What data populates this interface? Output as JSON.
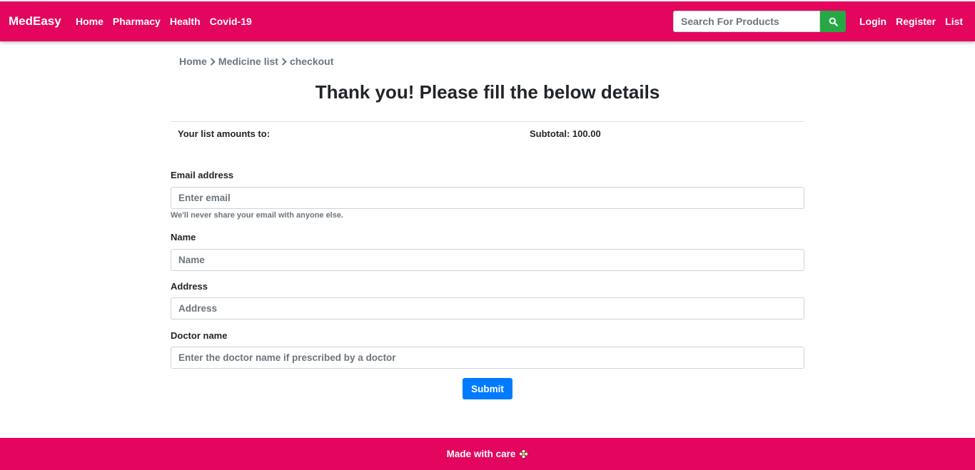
{
  "navbar": {
    "brand": "MedEasy",
    "links": [
      "Home",
      "Pharmacy",
      "Health",
      "Covid-19"
    ],
    "search": {
      "placeholder": "Search For Products",
      "icon": "search-icon"
    },
    "auth_links": [
      "Login",
      "Register",
      "List"
    ],
    "color": "#e4065e"
  },
  "breadcrumb": [
    "Home",
    "Medicine list",
    "checkout"
  ],
  "page": {
    "title": "Thank you! Please fill the below details",
    "summary_label": "Your list amounts to:",
    "subtotal": "Subtotal: 100.00"
  },
  "form": {
    "email": {
      "label": "Email address",
      "placeholder": "Enter email",
      "help": "We'll never share your email with anyone else."
    },
    "name": {
      "label": "Name",
      "placeholder": "Name"
    },
    "address": {
      "label": "Address",
      "placeholder": "Address"
    },
    "doctor": {
      "label": "Doctor name",
      "placeholder": "Enter the doctor name if prescribed by a doctor"
    },
    "submit_label": "Submit"
  },
  "footer": {
    "text": "Made with care",
    "icon": "flower-icon"
  },
  "colors": {
    "brand": "#e4065e",
    "search_button": "#28a745",
    "submit_button": "#007bff"
  }
}
